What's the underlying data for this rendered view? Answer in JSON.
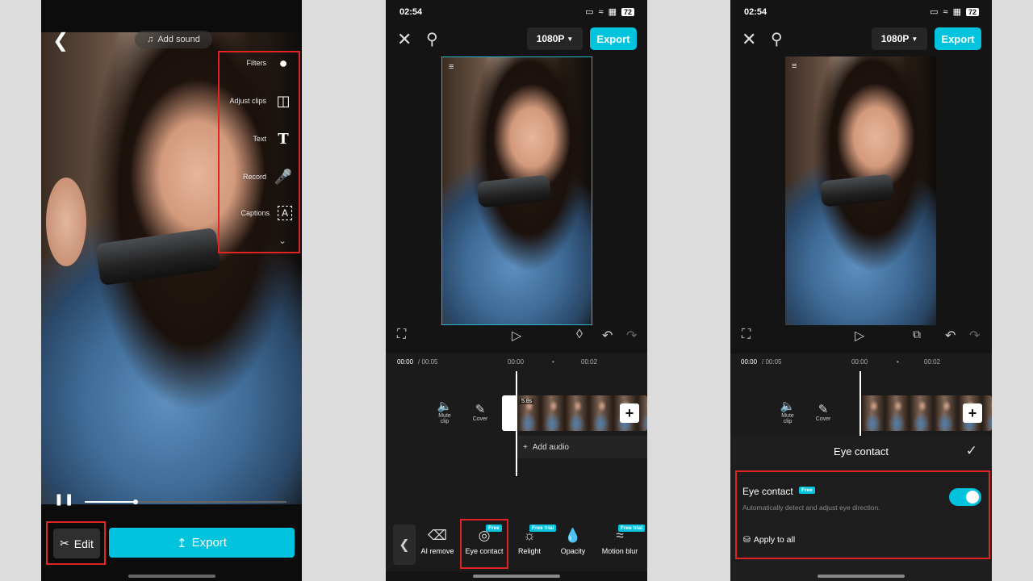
{
  "screen1": {
    "add_sound": "Add sound",
    "side_menu": [
      {
        "label": "Filters",
        "icon": "filters-icon"
      },
      {
        "label": "Adjust clips",
        "icon": "adjust-clips-icon"
      },
      {
        "label": "Text",
        "icon": "text-icon"
      },
      {
        "label": "Record",
        "icon": "microphone-icon"
      },
      {
        "label": "Captions",
        "icon": "captions-icon"
      }
    ],
    "playback_progress": 0.24,
    "edit_label": "Edit",
    "export_label": "Export"
  },
  "screen2": {
    "status": {
      "time": "02:54",
      "battery": "72"
    },
    "resolution": "1080P",
    "export_label": "Export",
    "timeline": {
      "current": "00:00",
      "total": "/ 00:05",
      "mark1": "00:00",
      "mark2": "00:02"
    },
    "mute_clip": "Mute clip",
    "cover": "Cover",
    "clip_duration": "5.8s",
    "add_audio": "Add audio",
    "tools": [
      {
        "label": "AI remove",
        "icon": "eraser-icon",
        "badge": ""
      },
      {
        "label": "Eye contact",
        "icon": "eye-contact-icon",
        "badge": "Free"
      },
      {
        "label": "Relight",
        "icon": "relight-icon",
        "badge": "Free trial"
      },
      {
        "label": "Opacity",
        "icon": "opacity-icon",
        "badge": ""
      },
      {
        "label": "Motion blur",
        "icon": "motion-blur-icon",
        "badge": "Free trial"
      }
    ]
  },
  "screen3": {
    "status": {
      "time": "02:54",
      "battery": "72"
    },
    "resolution": "1080P",
    "export_label": "Export",
    "timeline": {
      "current": "00:00",
      "total": "/ 00:05",
      "mark1": "00:00",
      "mark2": "00:02"
    },
    "mute_clip": "Mute clip",
    "cover": "Cover",
    "panel": {
      "title": "Eye contact",
      "option_label": "Eye contact",
      "option_badge": "Free",
      "description": "Automatically detect and adjust eye direction.",
      "toggle_on": true,
      "apply_all": "Apply to all"
    }
  },
  "colors": {
    "accent": "#00c4de",
    "highlight": "#e02424",
    "background": "#dcdcdc"
  }
}
